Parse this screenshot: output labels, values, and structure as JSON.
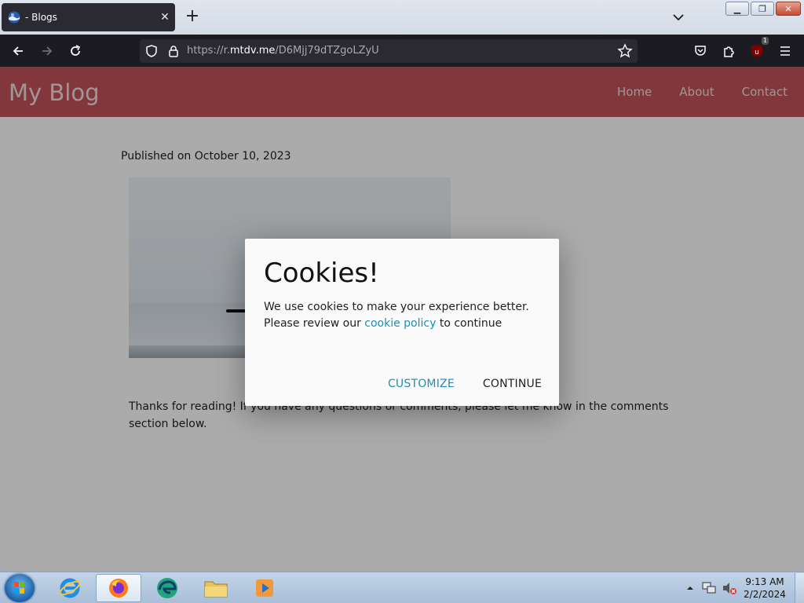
{
  "browser": {
    "tab_title": "- Blogs",
    "url_prefix": "https://r.",
    "url_host": "mtdv.me",
    "url_path": "/D6Mjj79dTZgoLZyU",
    "extension_badge": "1"
  },
  "site": {
    "title": "My Blog",
    "nav": [
      "Home",
      "About",
      "Contact"
    ]
  },
  "article": {
    "published": "Published on October 10, 2023",
    "body": "Thanks for reading! If you have any questions or comments, please let me know in the comments section below."
  },
  "cookie_modal": {
    "title": "Cookies!",
    "line1": "We use cookies to make your experience better.",
    "line2_before": "Please review our ",
    "link_text": "cookie policy",
    "line2_after": " to continue",
    "customize_label": "CUSTOMIZE",
    "continue_label": "CONTINUE"
  },
  "taskbar": {
    "time": "9:13 AM",
    "date": "2/2/2024"
  },
  "colors": {
    "header": "#c0535a",
    "link": "#1c8fb6"
  }
}
